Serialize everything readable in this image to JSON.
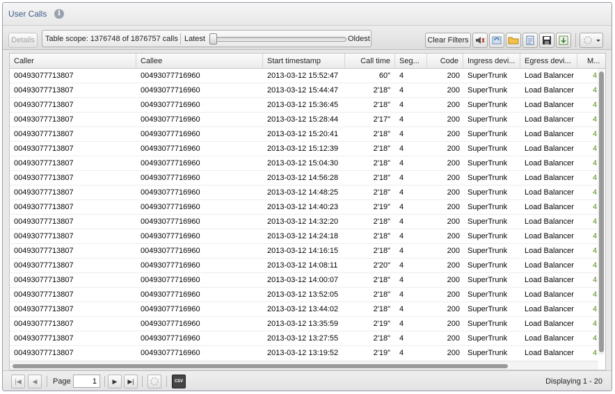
{
  "panel": {
    "title": "User Calls"
  },
  "toolbar": {
    "details_label": "Details",
    "scope_text": "Table scope: 1376748 of 1876757 calls",
    "latest_label": "Latest",
    "oldest_label": "Oldest",
    "clear_filters_label": "Clear Filters",
    "icons": [
      "speaker-icon",
      "refresh-icon",
      "folder-icon",
      "export-icon",
      "save-icon",
      "download-icon",
      "settings-dropdown-icon"
    ]
  },
  "grid": {
    "columns": [
      "Caller",
      "Callee",
      "Start timestamp",
      "Call time",
      "Seg...",
      "Code",
      "Ingress devi...",
      "Egress devi...",
      "M..."
    ],
    "rows": [
      [
        "00493077713807",
        "00493077716960",
        "2013-03-12 15:52:47",
        "60\"",
        "4",
        "200",
        "SuperTrunk",
        "Load Balancer",
        "4"
      ],
      [
        "00493077713807",
        "00493077716960",
        "2013-03-12 15:44:47",
        "2'18\"",
        "4",
        "200",
        "SuperTrunk",
        "Load Balancer",
        "4"
      ],
      [
        "00493077713807",
        "00493077716960",
        "2013-03-12 15:36:45",
        "2'18\"",
        "4",
        "200",
        "SuperTrunk",
        "Load Balancer",
        "4"
      ],
      [
        "00493077713807",
        "00493077716960",
        "2013-03-12 15:28:44",
        "2'17\"",
        "4",
        "200",
        "SuperTrunk",
        "Load Balancer",
        "4"
      ],
      [
        "00493077713807",
        "00493077716960",
        "2013-03-12 15:20:41",
        "2'18\"",
        "4",
        "200",
        "SuperTrunk",
        "Load Balancer",
        "4"
      ],
      [
        "00493077713807",
        "00493077716960",
        "2013-03-12 15:12:39",
        "2'18\"",
        "4",
        "200",
        "SuperTrunk",
        "Load Balancer",
        "4"
      ],
      [
        "00493077713807",
        "00493077716960",
        "2013-03-12 15:04:30",
        "2'18\"",
        "4",
        "200",
        "SuperTrunk",
        "Load Balancer",
        "4"
      ],
      [
        "00493077713807",
        "00493077716960",
        "2013-03-12 14:56:28",
        "2'18\"",
        "4",
        "200",
        "SuperTrunk",
        "Load Balancer",
        "4"
      ],
      [
        "00493077713807",
        "00493077716960",
        "2013-03-12 14:48:25",
        "2'18\"",
        "4",
        "200",
        "SuperTrunk",
        "Load Balancer",
        "4"
      ],
      [
        "00493077713807",
        "00493077716960",
        "2013-03-12 14:40:23",
        "2'19\"",
        "4",
        "200",
        "SuperTrunk",
        "Load Balancer",
        "4"
      ],
      [
        "00493077713807",
        "00493077716960",
        "2013-03-12 14:32:20",
        "2'18\"",
        "4",
        "200",
        "SuperTrunk",
        "Load Balancer",
        "4"
      ],
      [
        "00493077713807",
        "00493077716960",
        "2013-03-12 14:24:18",
        "2'18\"",
        "4",
        "200",
        "SuperTrunk",
        "Load Balancer",
        "4"
      ],
      [
        "00493077713807",
        "00493077716960",
        "2013-03-12 14:16:15",
        "2'18\"",
        "4",
        "200",
        "SuperTrunk",
        "Load Balancer",
        "4"
      ],
      [
        "00493077713807",
        "00493077716960",
        "2013-03-12 14:08:11",
        "2'20\"",
        "4",
        "200",
        "SuperTrunk",
        "Load Balancer",
        "4"
      ],
      [
        "00493077713807",
        "00493077716960",
        "2013-03-12 14:00:07",
        "2'18\"",
        "4",
        "200",
        "SuperTrunk",
        "Load Balancer",
        "4"
      ],
      [
        "00493077713807",
        "00493077716960",
        "2013-03-12 13:52:05",
        "2'18\"",
        "4",
        "200",
        "SuperTrunk",
        "Load Balancer",
        "4"
      ],
      [
        "00493077713807",
        "00493077716960",
        "2013-03-12 13:44:02",
        "2'18\"",
        "4",
        "200",
        "SuperTrunk",
        "Load Balancer",
        "4"
      ],
      [
        "00493077713807",
        "00493077716960",
        "2013-03-12 13:35:59",
        "2'19\"",
        "4",
        "200",
        "SuperTrunk",
        "Load Balancer",
        "4"
      ],
      [
        "00493077713807",
        "00493077716960",
        "2013-03-12 13:27:55",
        "2'18\"",
        "4",
        "200",
        "SuperTrunk",
        "Load Balancer",
        "4"
      ],
      [
        "00493077713807",
        "00493077716960",
        "2013-03-12 13:19:52",
        "2'19\"",
        "4",
        "200",
        "SuperTrunk",
        "Load Balancer",
        "4"
      ]
    ]
  },
  "pager": {
    "page_label": "Page",
    "page_value": "1",
    "display_text": "Displaying 1 - 20",
    "csv_icon_text": "CSV"
  },
  "colors": {
    "title": "#3c5a8a",
    "last_column_text": "#5a8a1e"
  }
}
